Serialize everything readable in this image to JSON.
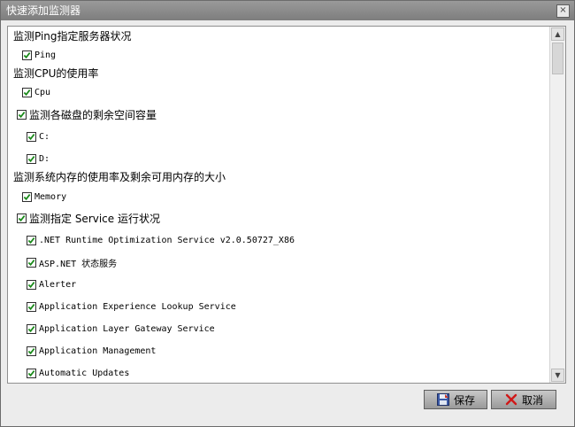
{
  "window": {
    "title": "快速添加监测器",
    "close_glyph": "×"
  },
  "groups": [
    {
      "heading": "监测Ping指定服务器状况",
      "items": [
        "Ping"
      ]
    },
    {
      "heading": "监测CPU的使用率",
      "items": [
        "Cpu"
      ]
    },
    {
      "checkbox_heading": "监测各磁盘的剩余空间容量",
      "items": [
        "C:",
        "D:"
      ]
    },
    {
      "heading": "监测系统内存的使用率及剩余可用内存的大小",
      "items": [
        "Memory"
      ]
    },
    {
      "checkbox_heading": "监测指定 Service 运行状况",
      "items": [
        ".NET Runtime Optimization Service v2.0.50727_X86",
        "ASP.NET 状态服务",
        "Alerter",
        "Application Experience Lookup Service",
        "Application Layer Gateway Service",
        "Application Management",
        "Automatic Updates"
      ]
    }
  ],
  "buttons": {
    "save": "保存",
    "cancel": "取消"
  },
  "scrollbar": {
    "up": "▲",
    "down": "▼"
  }
}
